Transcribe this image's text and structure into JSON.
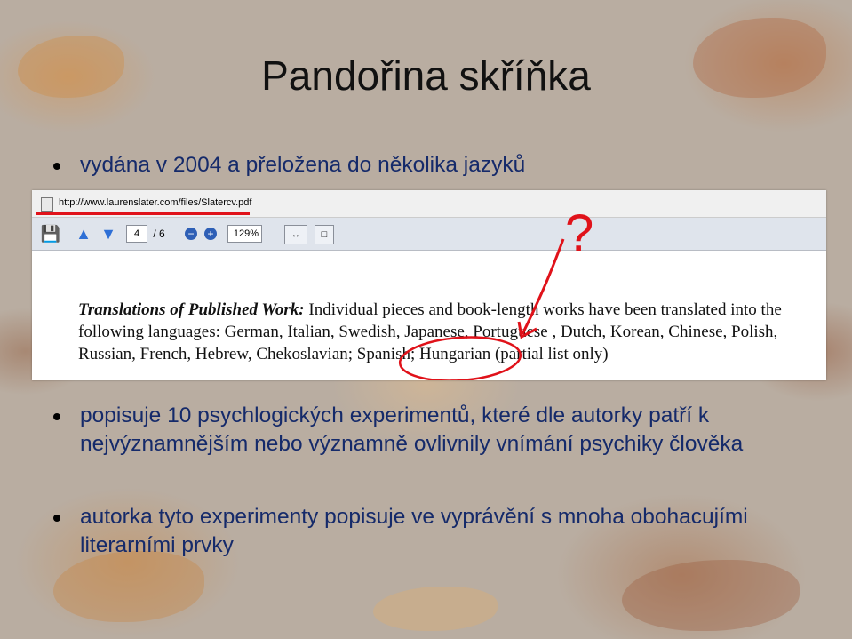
{
  "slide": {
    "title": "Pandořina skříňka",
    "bullets": [
      "vydána v 2004 a přeložena do několika jazyků",
      "popisuje 10 psychlogických experimentů, které dle autorky patří k nejvýznamnějším nebo významně ovlivnily vnímání psychiky člověka",
      "autorka tyto experimenty popisuje ve vyprávění s mnoha obohacujími literarními prvky"
    ]
  },
  "screenshot": {
    "url": "http://www.laurenslater.com/files/Slatercv.pdf",
    "page_current": "4",
    "page_total": "/ 6",
    "zoom": "129%",
    "doc_heading": "Translations of Published Work:",
    "doc_text_1": " Individual pieces and book-length works have been translated into the following languages: German, Italian, Swedish, Japanese, Portuguese , Dutch, Korean, Chinese, Polish, Russian, French, Hebrew, ",
    "doc_highlight": "Chekoslavian;",
    "doc_text_2": " Spanish; Hungarian (partial list only)",
    "annotation_mark": "?"
  },
  "colors": {
    "annotation": "#e0121a",
    "bullet_text": "#152a6a"
  }
}
